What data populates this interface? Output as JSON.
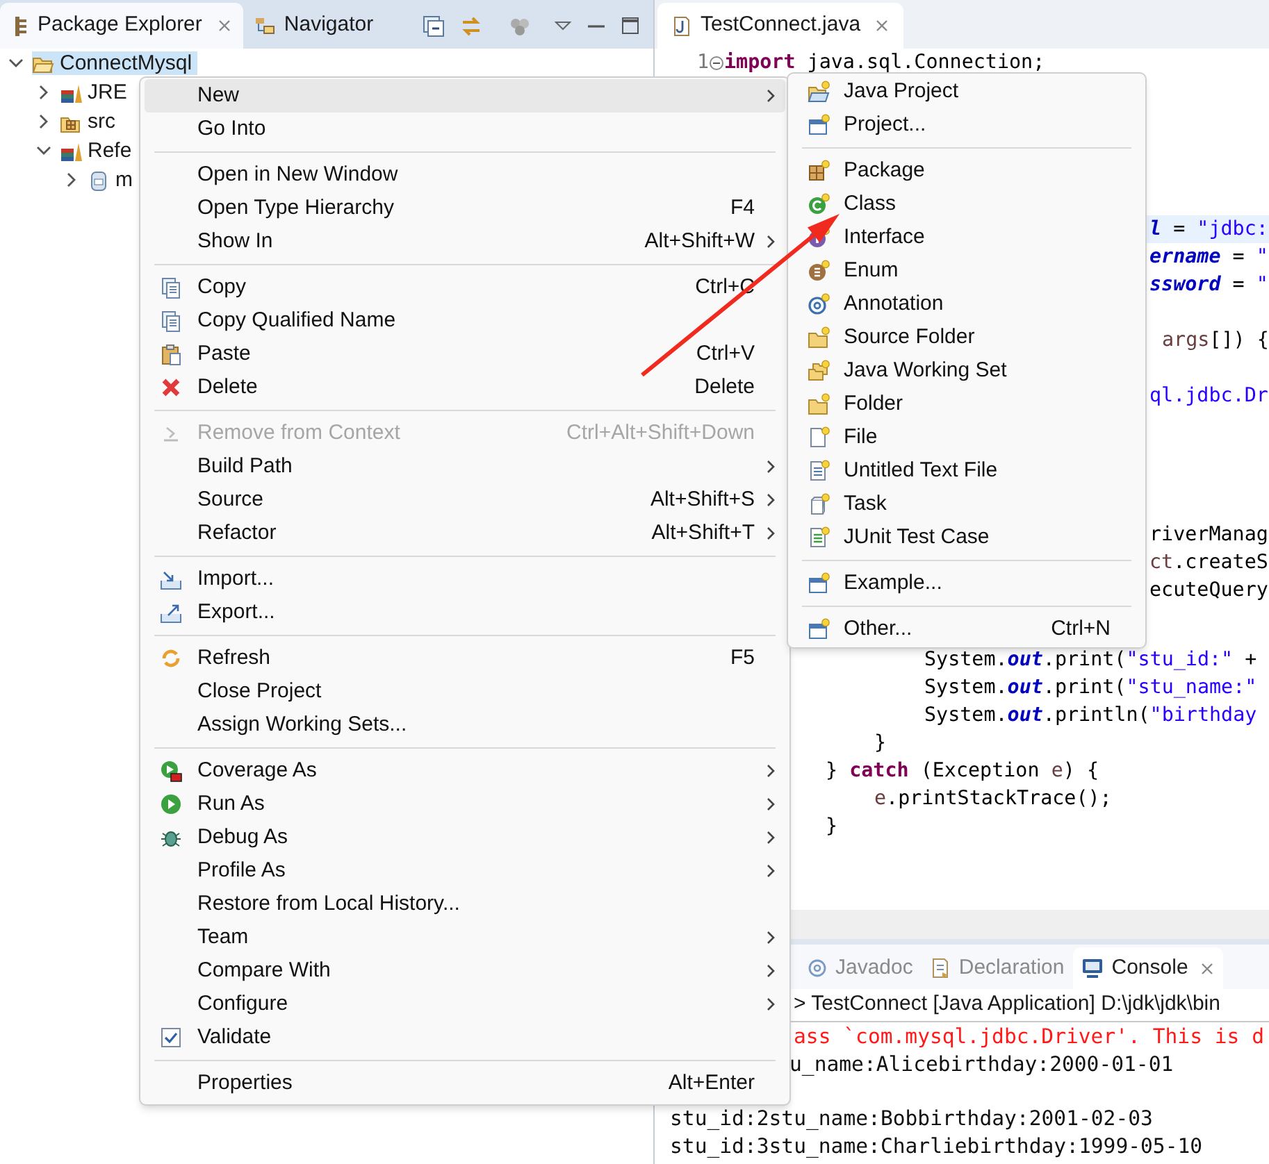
{
  "package_explorer": {
    "tabs": [
      {
        "label": "Package Explorer",
        "selected": true
      },
      {
        "label": "Navigator",
        "selected": false
      }
    ],
    "tree": [
      {
        "label": "ConnectMysql",
        "kind": "project",
        "expanded": true,
        "selected": true,
        "children": [
          {
            "label": "JRE",
            "kind": "library",
            "expanded": false,
            "selected": false
          },
          {
            "label": "src",
            "kind": "source-folder",
            "expanded": false,
            "selected": false
          },
          {
            "label": "Refe",
            "kind": "library",
            "expanded": true,
            "selected": false,
            "children": [
              {
                "label": "m",
                "kind": "jar",
                "expanded": false,
                "selected": false
              }
            ]
          }
        ]
      }
    ]
  },
  "editor": {
    "tabs": [
      {
        "label": "TestConnect.java",
        "selected": true
      }
    ],
    "code_lines": [
      {
        "number": "1",
        "highlighted": false,
        "tokens": [
          {
            "text": "import",
            "kind": "keyword"
          },
          {
            "text": " java.sql.Connection;",
            "kind": "plain"
          }
        ]
      },
      {
        "highlighted": true,
        "tokens": [
          {
            "text": "l",
            "kind": "field"
          },
          {
            "text": " = ",
            "kind": "plain"
          },
          {
            "text": "\"jdbc:",
            "kind": "string"
          }
        ]
      },
      {
        "highlighted": false,
        "tokens": [
          {
            "text": "ername",
            "kind": "field"
          },
          {
            "text": " = ",
            "kind": "plain"
          },
          {
            "text": "\"",
            "kind": "string"
          }
        ]
      },
      {
        "highlighted": false,
        "tokens": [
          {
            "text": "ssword",
            "kind": "field"
          },
          {
            "text": " = ",
            "kind": "plain"
          },
          {
            "text": "\"",
            "kind": "string"
          }
        ]
      },
      {
        "highlighted": false,
        "tokens": [
          {
            "text": "args",
            "kind": "variable"
          },
          {
            "text": "[]) {",
            "kind": "plain"
          }
        ]
      },
      {
        "highlighted": false,
        "tokens": [
          {
            "text": "ql.jdbc.Dr",
            "kind": "string"
          }
        ]
      },
      {
        "highlighted": false,
        "tokens": [
          {
            "text": "riverManag",
            "kind": "plain"
          }
        ]
      },
      {
        "highlighted": false,
        "tokens": [
          {
            "text": "ct",
            "kind": "variable"
          },
          {
            "text": ".createS",
            "kind": "plain"
          }
        ]
      },
      {
        "highlighted": false,
        "tokens": [
          {
            "text": "ecuteQuery",
            "kind": "plain"
          }
        ]
      },
      {
        "highlighted": false,
        "tokens": [
          {
            "text": "System.",
            "kind": "plain"
          },
          {
            "text": "out",
            "kind": "field"
          },
          {
            "text": ".print(",
            "kind": "plain"
          },
          {
            "text": "\"stu_id:\"",
            "kind": "string"
          },
          {
            "text": " +",
            "kind": "plain"
          }
        ]
      },
      {
        "highlighted": false,
        "tokens": [
          {
            "text": "System.",
            "kind": "plain"
          },
          {
            "text": "out",
            "kind": "field"
          },
          {
            "text": ".print(",
            "kind": "plain"
          },
          {
            "text": "\"stu_name:\"",
            "kind": "string"
          }
        ]
      },
      {
        "highlighted": false,
        "tokens": [
          {
            "text": "System.",
            "kind": "plain"
          },
          {
            "text": "out",
            "kind": "field"
          },
          {
            "text": ".println(",
            "kind": "plain"
          },
          {
            "text": "\"birthday",
            "kind": "string"
          }
        ]
      },
      {
        "highlighted": false,
        "tokens": [
          {
            "text": "}",
            "kind": "plain"
          }
        ]
      },
      {
        "highlighted": false,
        "tokens": [
          {
            "text": "} ",
            "kind": "plain"
          },
          {
            "text": "catch",
            "kind": "keyword"
          },
          {
            "text": " (Exception ",
            "kind": "plain"
          },
          {
            "text": "e",
            "kind": "variable"
          },
          {
            "text": ") {",
            "kind": "plain"
          }
        ]
      },
      {
        "highlighted": false,
        "tokens": [
          {
            "text": "e",
            "kind": "variable"
          },
          {
            "text": ".printStackTrace();",
            "kind": "plain"
          }
        ]
      },
      {
        "highlighted": false,
        "tokens": [
          {
            "text": "}",
            "kind": "plain"
          }
        ]
      }
    ]
  },
  "context_menu": {
    "groups": [
      [
        {
          "label": "New",
          "kind": "plain",
          "submenu": true,
          "disabled": false,
          "selected": true
        },
        {
          "label": "Go Into",
          "kind": "plain",
          "submenu": false,
          "disabled": false,
          "selected": false
        }
      ],
      [
        {
          "label": "Open in New Window",
          "kind": "plain",
          "submenu": false,
          "disabled": false,
          "selected": false
        },
        {
          "label": "Open Type Hierarchy",
          "kind": "plain",
          "shortcut": "F4",
          "submenu": false,
          "disabled": false,
          "selected": false
        },
        {
          "label": "Show In",
          "kind": "plain",
          "shortcut": "Alt+Shift+W",
          "submenu": true,
          "disabled": false,
          "selected": false
        }
      ],
      [
        {
          "label": "Copy",
          "kind": "copy",
          "shortcut": "Ctrl+C",
          "submenu": false,
          "disabled": false,
          "selected": false
        },
        {
          "label": "Copy Qualified Name",
          "kind": "copy",
          "submenu": false,
          "disabled": false,
          "selected": false
        },
        {
          "label": "Paste",
          "kind": "paste",
          "shortcut": "Ctrl+V",
          "submenu": false,
          "disabled": false,
          "selected": false
        },
        {
          "label": "Delete",
          "kind": "delete",
          "shortcut": "Delete",
          "submenu": false,
          "disabled": false,
          "selected": false
        }
      ],
      [
        {
          "label": "Remove from Context",
          "kind": "remove",
          "shortcut": "Ctrl+Alt+Shift+Down",
          "submenu": false,
          "disabled": true,
          "selected": false
        },
        {
          "label": "Build Path",
          "kind": "plain",
          "submenu": true,
          "disabled": false,
          "selected": false
        },
        {
          "label": "Source",
          "kind": "plain",
          "shortcut": "Alt+Shift+S",
          "submenu": true,
          "disabled": false,
          "selected": false
        },
        {
          "label": "Refactor",
          "kind": "plain",
          "shortcut": "Alt+Shift+T",
          "submenu": true,
          "disabled": false,
          "selected": false
        }
      ],
      [
        {
          "label": "Import...",
          "kind": "import",
          "submenu": false,
          "disabled": false,
          "selected": false
        },
        {
          "label": "Export...",
          "kind": "export",
          "submenu": false,
          "disabled": false,
          "selected": false
        }
      ],
      [
        {
          "label": "Refresh",
          "kind": "refresh",
          "shortcut": "F5",
          "submenu": false,
          "disabled": false,
          "selected": false
        },
        {
          "label": "Close Project",
          "kind": "plain",
          "submenu": false,
          "disabled": false,
          "selected": false
        },
        {
          "label": "Assign Working Sets...",
          "kind": "plain",
          "submenu": false,
          "disabled": false,
          "selected": false
        }
      ],
      [
        {
          "label": "Coverage As",
          "kind": "coverage",
          "submenu": true,
          "disabled": false,
          "selected": false
        },
        {
          "label": "Run As",
          "kind": "run",
          "submenu": true,
          "disabled": false,
          "selected": false
        },
        {
          "label": "Debug As",
          "kind": "debug",
          "submenu": true,
          "disabled": false,
          "selected": false
        },
        {
          "label": "Profile As",
          "kind": "plain",
          "submenu": true,
          "disabled": false,
          "selected": false
        },
        {
          "label": "Restore from Local History...",
          "kind": "plain",
          "submenu": false,
          "disabled": false,
          "selected": false
        },
        {
          "label": "Team",
          "kind": "plain",
          "submenu": true,
          "disabled": false,
          "selected": false
        },
        {
          "label": "Compare With",
          "kind": "plain",
          "submenu": true,
          "disabled": false,
          "selected": false
        },
        {
          "label": "Configure",
          "kind": "plain",
          "submenu": true,
          "disabled": false,
          "selected": false
        },
        {
          "label": "Validate",
          "kind": "checkbox",
          "submenu": false,
          "disabled": false,
          "selected": false
        }
      ],
      [
        {
          "label": "Properties",
          "kind": "plain",
          "shortcut": "Alt+Enter",
          "submenu": false,
          "disabled": false,
          "selected": false
        }
      ]
    ]
  },
  "new_submenu": {
    "groups": [
      [
        {
          "label": "Java Project",
          "kind": "java-project"
        },
        {
          "label": "Project...",
          "kind": "window"
        }
      ],
      [
        {
          "label": "Package",
          "kind": "package"
        },
        {
          "label": "Class",
          "kind": "class"
        },
        {
          "label": "Interface",
          "kind": "interface"
        },
        {
          "label": "Enum",
          "kind": "enum"
        },
        {
          "label": "Annotation",
          "kind": "annotation"
        },
        {
          "label": "Source Folder",
          "kind": "source-folder"
        },
        {
          "label": "Java Working Set",
          "kind": "working-set"
        },
        {
          "label": "Folder",
          "kind": "folder"
        },
        {
          "label": "File",
          "kind": "file"
        },
        {
          "label": "Untitled Text File",
          "kind": "text-file"
        },
        {
          "label": "Task",
          "kind": "task"
        },
        {
          "label": "JUnit Test Case",
          "kind": "junit"
        }
      ],
      [
        {
          "label": "Example...",
          "kind": "window"
        }
      ],
      [
        {
          "label": "Other...",
          "kind": "window",
          "shortcut": "Ctrl+N"
        }
      ]
    ]
  },
  "bottom_panel": {
    "tabs": [
      {
        "label": "Javadoc",
        "kind": "javadoc",
        "selected": false
      },
      {
        "label": "Declaration",
        "kind": "declaration",
        "selected": false
      },
      {
        "label": "Console",
        "kind": "console",
        "selected": true
      }
    ],
    "console_header": "> TestConnect [Java Application] D:\\jdk\\jdk\\bin",
    "output": [
      {
        "text": "ass `com.mysql.jdbc.Driver'. This is d",
        "kind": "error"
      },
      {
        "text": "u_name:Alicebirthday:2000-01-01",
        "kind": "normal"
      },
      {
        "text": "stu_id:2stu_name:Bobbirthday:2001-02-03",
        "kind": "normal"
      },
      {
        "text": "stu_id:3stu_name:Charliebirthday:1999-05-10",
        "kind": "normal"
      }
    ]
  }
}
